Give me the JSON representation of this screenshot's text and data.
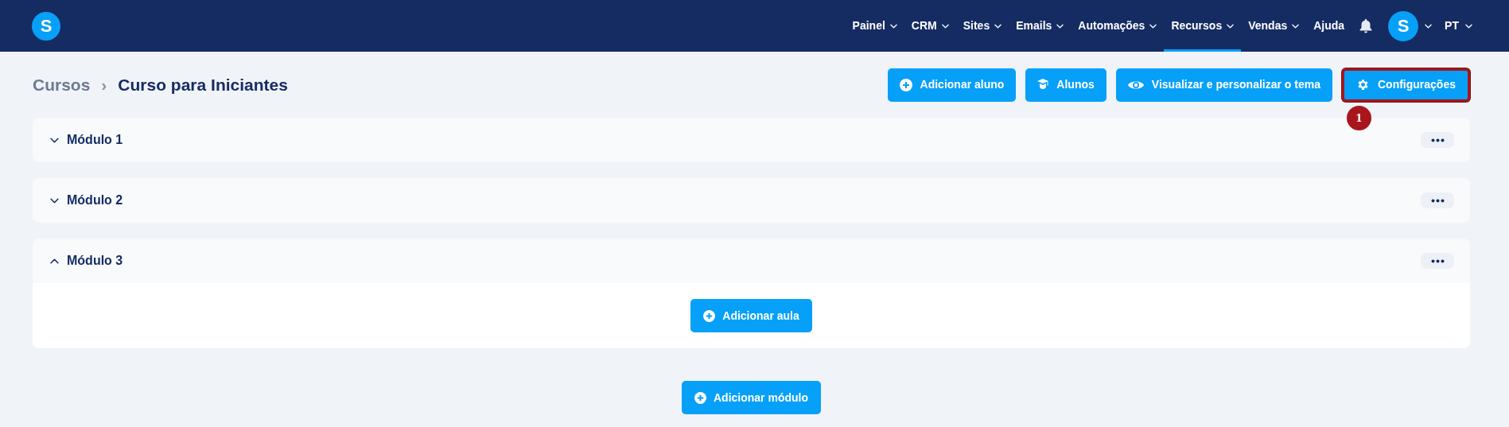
{
  "nav": {
    "items": [
      {
        "label": "Painel",
        "caret": true,
        "selected": false
      },
      {
        "label": "CRM",
        "caret": true,
        "selected": false
      },
      {
        "label": "Sites",
        "caret": true,
        "selected": false
      },
      {
        "label": "Emails",
        "caret": true,
        "selected": false
      },
      {
        "label": "Automações",
        "caret": true,
        "selected": false
      },
      {
        "label": "Recursos",
        "caret": true,
        "selected": true
      },
      {
        "label": "Vendas",
        "caret": true,
        "selected": false
      },
      {
        "label": "Ajuda",
        "caret": false,
        "selected": false
      }
    ],
    "avatar_letter": "S",
    "language": "PT",
    "logo_letter": "S"
  },
  "breadcrumb": {
    "parent": "Cursos",
    "separator": "›",
    "current": "Curso para Iniciantes"
  },
  "actions": [
    {
      "label": "Adicionar aluno",
      "kind": "plus",
      "highlighted": false
    },
    {
      "label": "Alunos",
      "kind": "cap",
      "highlighted": false
    },
    {
      "label": "Visualizar e personalizar o tema",
      "kind": "eye",
      "highlighted": false
    },
    {
      "label": "Configurações",
      "kind": "gear",
      "highlighted": true
    }
  ],
  "callout": "1",
  "modules": [
    {
      "title": "Módulo 1",
      "expanded": false
    },
    {
      "title": "Módulo 2",
      "expanded": false
    },
    {
      "title": "Módulo 3",
      "expanded": true,
      "button": "Adicionar aula"
    }
  ],
  "add_module_button": "Adicionar módulo"
}
